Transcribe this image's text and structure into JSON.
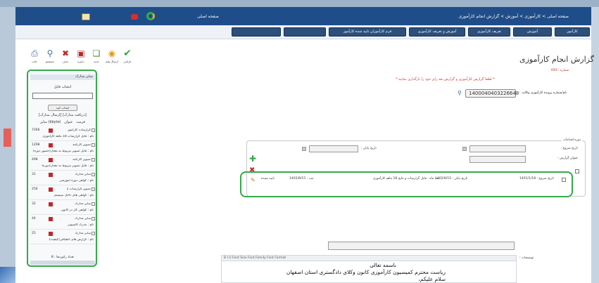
{
  "header": {
    "title": "صفحه اصلی > کارآموزی > آموزش > گزارش انجام کارآموزی",
    "home_label": "صفحه اصلی",
    "user_label": "کارتابل"
  },
  "menu": {
    "tabs": [
      "کارآموز",
      "آموزش",
      "تعریف کارآموزی",
      "آموزش و تعریف کارآموزی",
      "فرم کارآموزان تایید شده کارآموز"
    ]
  },
  "toolbar": {
    "items": [
      {
        "label": "بازیابی",
        "icon": "check-icon"
      },
      {
        "label": "ارسال پیام",
        "icon": "chat-icon"
      },
      {
        "label": "جدید",
        "icon": "new-document-icon"
      },
      {
        "label": "ذخیره",
        "icon": "save-icon"
      },
      {
        "label": "حذف",
        "icon": "delete-icon"
      },
      {
        "label": "جستجو",
        "icon": "search-icon"
      },
      {
        "label": "چاپ",
        "icon": "print-icon"
      }
    ]
  },
  "docs_panel": {
    "header": "سایر مدارک",
    "choose_file": "انتخاب فایل",
    "file_button": "انتخاب کنید",
    "list_header": "[ارسال مدارک] [دریافت مدارک]",
    "columns": [
      "عنوان",
      "فرمت",
      "سایز (kbyte)"
    ],
    "rows": [
      {
        "size": "7266",
        "name": "گزارشات کارآموز",
        "desc": "نام : فایل گزارشات 18 ماهه کارآموزی"
      },
      {
        "size": "1298",
        "name": "تصویر کارنامه",
        "desc": "نام : فایل تصویر مربوط به معدل(حضور دوره)"
      },
      {
        "size": "498",
        "name": "تصویر کارنامه",
        "desc": "نام : فایل تصویر مربوط به معدل(دوره)"
      },
      {
        "size": "31",
        "name": "سایر مدارک",
        "desc": "نام : گواهی دوره آموزشی"
      },
      {
        "size": "256",
        "name": "تصویر گزارشات 2",
        "desc": "نام : گواهی های داخل سیستم"
      },
      {
        "size": "32",
        "name": "سایر مدارک",
        "desc": "نام : گواهی کار در کانون"
      },
      {
        "size": "44",
        "name": "سایر مدارک",
        "desc": "نام : مدرک کامپیوتر"
      },
      {
        "size": "25",
        "name": "سایر مدارک",
        "desc": "نام : گزارش های انطباقی(کیفیت)"
      }
    ],
    "count": "تعداد رکوردها : 8"
  },
  "form": {
    "title": "گزارش انجام کارآموزی",
    "subtitle": "شماره : 693",
    "notice": "* لطفا گزارش کارآموزی و گزارش بعد رای خود را بارگذاری نمایید.*",
    "case_label": "نام/شماره پرونده کارآموزی وکالت :",
    "case_value": "1400040403226648",
    "fieldset_legend": "دوره اقدامات",
    "start_date_label": "تاریخ شروع :",
    "end_date_label": "تاریخ پایان :",
    "report_title_label": "عنوان گزارش :"
  },
  "activity": {
    "start": "تاریخ شروع : 1401/1/18",
    "end": "تاریخ پایان : 1402/8/15",
    "desc": "سه ماه : فایل گزارشات و نتایج 18 ماهه کارآموزی",
    "reg_date": "ثبت : 1402/8/15",
    "status": "تایید نشده"
  },
  "editor": {
    "desc_label": "توضیحات :",
    "toolbar_text": "B I U  Font Size  Font Family  Font Format",
    "lines": [
      "باسمه تعالی",
      "ریاست محترم کمیسیون کارآموزی کانون وکلای دادگستری استان اصفهان",
      "سلام علیکم،"
    ]
  }
}
